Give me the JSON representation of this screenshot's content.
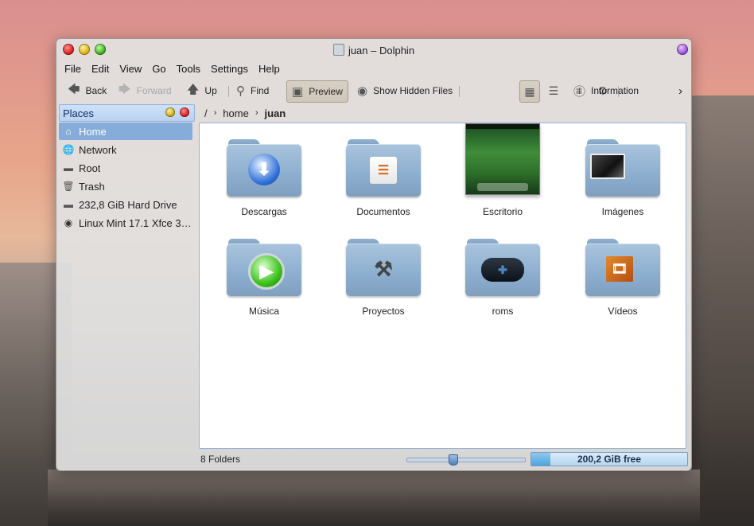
{
  "window": {
    "title": "juan – Dolphin"
  },
  "menubar": [
    "File",
    "Edit",
    "View",
    "Go",
    "Tools",
    "Settings",
    "Help"
  ],
  "toolbar": {
    "back": "Back",
    "forward": "Forward",
    "up": "Up",
    "find": "Find",
    "preview": "Preview",
    "show_hidden": "Show Hidden Files",
    "information": "Information"
  },
  "places": {
    "title": "Places",
    "items": [
      {
        "label": "Home",
        "icon": "home-icon",
        "selected": true
      },
      {
        "label": "Network",
        "icon": "network-icon"
      },
      {
        "label": "Root",
        "icon": "drive-icon"
      },
      {
        "label": "Trash",
        "icon": "trash-icon"
      },
      {
        "label": "232,8 GiB Hard Drive",
        "icon": "drive-icon"
      },
      {
        "label": "Linux Mint 17.1 Xfce 3…",
        "icon": "disc-icon"
      }
    ]
  },
  "breadcrumb": {
    "root": "/",
    "parts": [
      "home",
      "juan"
    ]
  },
  "folders": [
    {
      "label": "Descargas",
      "icon": "download-icon"
    },
    {
      "label": "Documentos",
      "icon": "documents-icon"
    },
    {
      "label": "Escritorio",
      "icon": "desktop-preview"
    },
    {
      "label": "Imágenes",
      "icon": "pictures-icon"
    },
    {
      "label": "Música",
      "icon": "music-icon"
    },
    {
      "label": "Proyectos",
      "icon": "tools-icon"
    },
    {
      "label": "roms",
      "icon": "gamepad-icon"
    },
    {
      "label": "Vídeos",
      "icon": "video-icon"
    }
  ],
  "status": {
    "text": "8 Folders",
    "free_space": "200,2 GiB free",
    "used_fraction": 0.12,
    "zoom_fraction": 0.38
  }
}
